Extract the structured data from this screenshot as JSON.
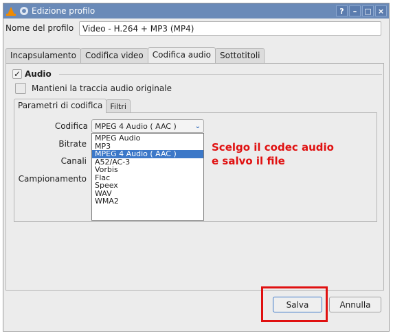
{
  "window": {
    "title": "Edizione profilo",
    "title_buttons": [
      "?",
      "–",
      "□",
      "×"
    ]
  },
  "profile": {
    "name_label": "Nome del profilo",
    "name_value": "Video - H.264 + MP3 (MP4)"
  },
  "tabs": [
    {
      "label": "Incapsulamento",
      "active": false
    },
    {
      "label": "Codifica video",
      "active": false
    },
    {
      "label": "Codifica audio",
      "active": true
    },
    {
      "label": "Sottotitoli",
      "active": false
    }
  ],
  "audio": {
    "enabled_label": "Audio",
    "enabled": true,
    "keep_original_label": "Mantieni la traccia audio originale",
    "keep_original": false
  },
  "subtabs": [
    {
      "label": "Parametri di codifica",
      "active": true
    },
    {
      "label": "Filtri",
      "active": false
    }
  ],
  "form": {
    "codec_label": "Codifica",
    "bitrate_label": "Bitrate",
    "channels_label": "Canali",
    "samplerate_label": "Campionamento",
    "codec_selected": "MPEG 4 Audio ( AAC )"
  },
  "codec_options": [
    "MPEG Audio",
    "MP3",
    "MPEG 4 Audio ( AAC )",
    "A52/AC-3",
    "Vorbis",
    "Flac",
    "Speex",
    "WAV",
    "WMA2"
  ],
  "annotation": {
    "line1": "Scelgo il codec audio",
    "line2": "e salvo il file",
    "color": "#e01010"
  },
  "buttons": {
    "save": "Salva",
    "cancel": "Annulla"
  },
  "icons": {
    "app": "vlc-cone-icon",
    "window_menu": "gear-icon",
    "dropdown": "chevron-down-icon",
    "checked": "checkmark-icon"
  },
  "colors": {
    "titlebar": "#6a8ab8",
    "selection": "#3c78c8",
    "highlight": "#e01010"
  }
}
